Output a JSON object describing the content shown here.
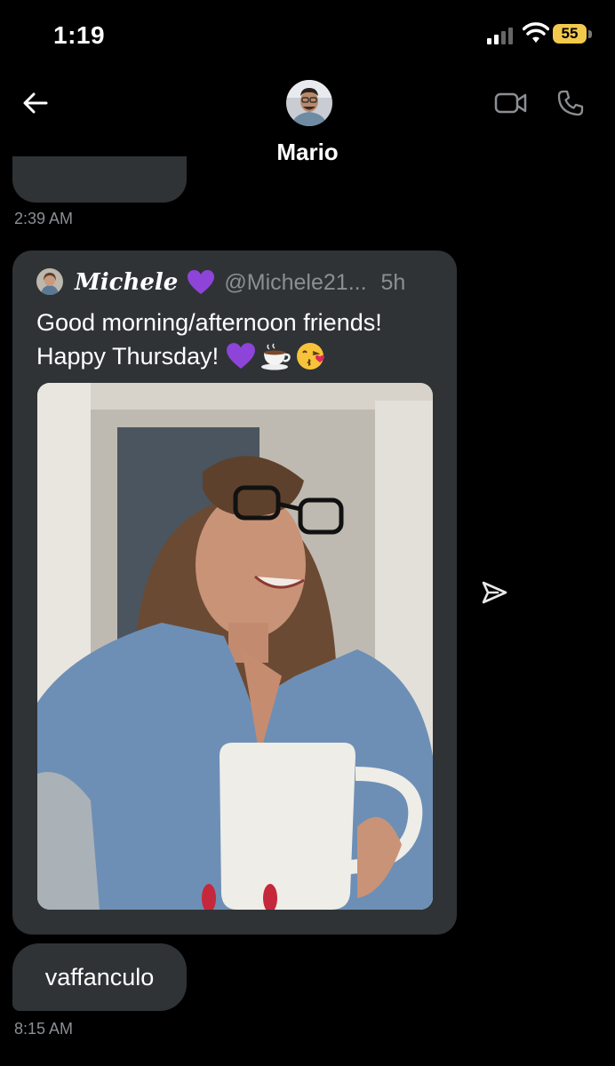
{
  "status_bar": {
    "time": "1:19",
    "battery": "55"
  },
  "header": {
    "contact_name": "Mario"
  },
  "messages": {
    "first_timestamp": "2:39 AM",
    "shared_tweet": {
      "author": "Michele",
      "handle": "@Michele21...",
      "age": "5h",
      "text_line1": "Good morning/afternoon friends!",
      "text_line2": "Happy Thursday!"
    },
    "reply_text": "vaffanculo",
    "second_timestamp": "8:15 AM"
  },
  "icons": {
    "back": "arrow-left-icon",
    "video": "video-call-icon",
    "phone": "phone-icon",
    "share": "share-icon",
    "heart": "purple-heart-emoji",
    "coffee": "coffee-emoji",
    "kiss": "kissing-face-emoji"
  },
  "colors": {
    "bubble": "#2f3336",
    "muted": "#8b8f94",
    "battery": "#f2c94c",
    "heart": "#8e44d9"
  }
}
